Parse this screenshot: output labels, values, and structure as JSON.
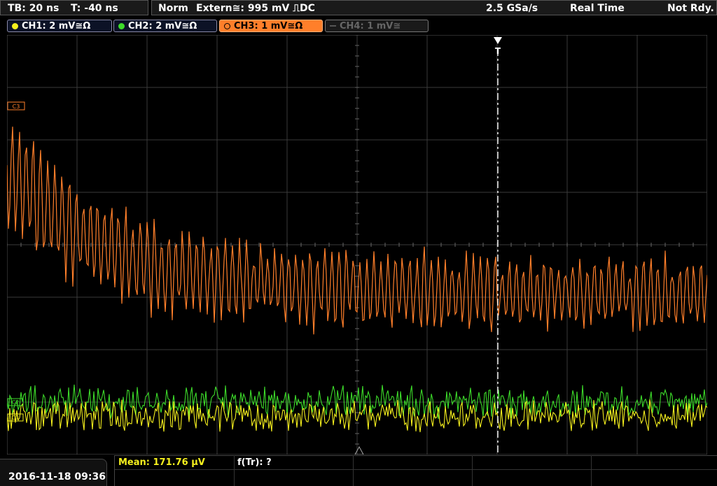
{
  "status": {
    "timebase": "TB: 20 ns",
    "trigger_offset": "T: -40 ns",
    "mode": "Norm",
    "trigger_source": "Extern≅: 995 mV ⎍DC",
    "sample_rate": "2.5 GSa/s",
    "acq_mode": "Real Time",
    "state": "Not Rdy."
  },
  "channels": [
    {
      "label": "CH1: 2 mV≅Ω",
      "color": "#f5f01e",
      "active": false
    },
    {
      "label": "CH2: 2 mV≅Ω",
      "color": "#3ddc2a",
      "active": false
    },
    {
      "label": "CH3: 1 mV≅Ω",
      "color": "#ff7f2a",
      "active": true
    },
    {
      "label": "CH4: 1 mV≅",
      "color": "#666666",
      "active": false
    }
  ],
  "measurements": {
    "mean": "Mean: 171.76 µV",
    "ftr": "f(Tr): ?"
  },
  "datetime": "2016-11-18 09:36",
  "colors": {
    "grid": "#3a3a3a",
    "ch1": "#f5f01e",
    "ch2": "#3ddc2a",
    "ch3": "#ff7f2a",
    "trigger_marker": "#ffffff"
  },
  "markers": {
    "ch3": "C3",
    "ch2": "C2",
    "ch1": "C1",
    "trigger": "T"
  }
}
